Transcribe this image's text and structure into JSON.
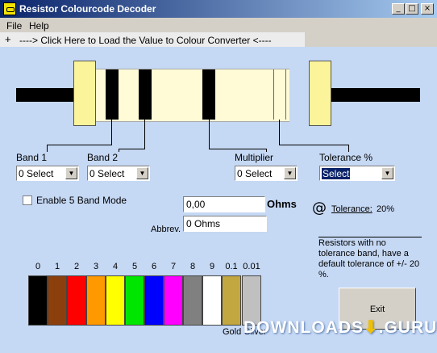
{
  "window": {
    "title": "Resistor Colourcode Decoder"
  },
  "title_buttons": {
    "minimize": "_",
    "maximize": "□",
    "close": "×"
  },
  "menu": {
    "file": "File",
    "help": "Help"
  },
  "link": {
    "text": "----> Click Here to Load the Value to Colour Converter <----"
  },
  "bands": [
    {
      "label": "Band 1",
      "value": "0 Select"
    },
    {
      "label": "Band 2",
      "value": "0 Select"
    },
    {
      "label": "Multiplier",
      "value": "0 Select"
    },
    {
      "label": "Tolerance %",
      "value": "Select"
    }
  ],
  "five_band": {
    "label": "Enable 5 Band Mode",
    "checked": false
  },
  "result": {
    "value": "0,00",
    "unit": "Ohms",
    "abbrev_label": "Abbrev.",
    "abbrev_value": "0 Ohms"
  },
  "tolerance": {
    "at_symbol": "@",
    "link": "Tolerance:",
    "value": "20%",
    "note": "Resistors with no tolerance band, have a default tolerance of +/- 20 %."
  },
  "colour_chart": {
    "numbers": [
      "0",
      "1",
      "2",
      "3",
      "4",
      "5",
      "6",
      "7",
      "8",
      "9",
      "0.1",
      "0.01"
    ],
    "colors": [
      "#000000",
      "#8b3f0c",
      "#ff0000",
      "#ff9900",
      "#ffff00",
      "#00e600",
      "#0000ff",
      "#ff00ff",
      "#808080",
      "#ffffff",
      "#c2a640",
      "#c0c0c0"
    ],
    "names": [
      "Gold",
      "Silver"
    ]
  },
  "exit_label": "Exit",
  "watermark": {
    "text": "DOWNLOADS",
    "suffix": ".GURU",
    "arrow": "⬇"
  }
}
